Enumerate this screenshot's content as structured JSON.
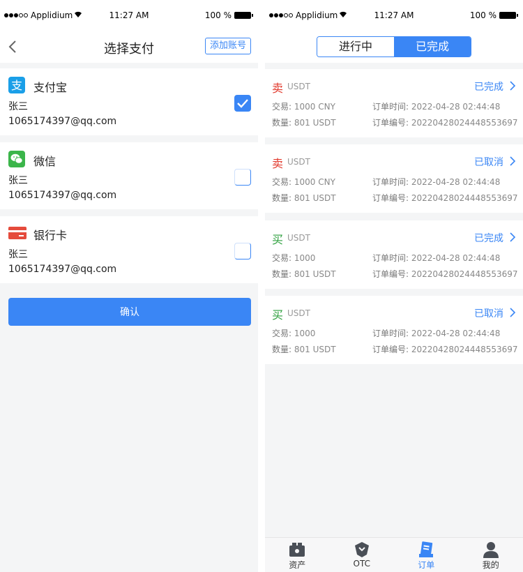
{
  "status_bar": {
    "carrier": "Applidium",
    "time": "11:27 AM",
    "battery": "100 %"
  },
  "select_payment": {
    "title": "选择支付",
    "add_account": "添加账号",
    "methods": [
      {
        "name": "支付宝",
        "holder": "张三",
        "account": "1065174397@qq.com",
        "icon": "alipay-icon",
        "selected": true
      },
      {
        "name": "微信",
        "holder": "张三",
        "account": "1065174397@qq.com",
        "icon": "wechat-icon",
        "selected": false
      },
      {
        "name": "银行卡",
        "holder": "张三",
        "account": "1065174397@qq.com",
        "icon": "bank-card-icon",
        "selected": false
      }
    ],
    "confirm": "确认"
  },
  "orders": {
    "tabs": [
      {
        "label": "进行中",
        "active": false
      },
      {
        "label": "已完成",
        "active": true
      }
    ],
    "labels": {
      "trade": "交易:",
      "quantity": "数量:",
      "order_time": "订单时间:",
      "order_no": "订单编号:"
    },
    "items": [
      {
        "side": "卖",
        "side_type": "sell",
        "coin": "USDT",
        "status": "已完成",
        "trade_amount": "1000",
        "trade_unit": "CNY",
        "quantity": "801",
        "quantity_unit": "USDT",
        "time": "2022-04-28 02:44:48",
        "order_no": "20220428024448553697"
      },
      {
        "side": "卖",
        "side_type": "sell",
        "coin": "USDT",
        "status": "已取消",
        "trade_amount": "1000",
        "trade_unit": "CNY",
        "quantity": "801",
        "quantity_unit": "USDT",
        "time": "2022-04-28 02:44:48",
        "order_no": "20220428024448553697"
      },
      {
        "side": "买",
        "side_type": "buy",
        "coin": "USDT",
        "status": "已完成",
        "trade_amount": "1000",
        "trade_unit": "",
        "quantity": "801",
        "quantity_unit": "USDT",
        "time": "2022-04-28 02:44:48",
        "order_no": "20220428024448553697"
      },
      {
        "side": "买",
        "side_type": "buy",
        "coin": "USDT",
        "status": "已取消",
        "trade_amount": "1000",
        "trade_unit": "",
        "quantity": "801",
        "quantity_unit": "USDT",
        "time": "2022-04-28 02:44:48",
        "order_no": "20220428024448553697"
      }
    ]
  },
  "tabbar": [
    {
      "label": "资产",
      "icon": "wallet-icon",
      "active": false
    },
    {
      "label": "OTC",
      "icon": "otc-icon",
      "active": false
    },
    {
      "label": "订单",
      "icon": "order-icon",
      "active": true
    },
    {
      "label": "我的",
      "icon": "user-icon",
      "active": false
    }
  ],
  "colors": {
    "accent": "#3a86f5",
    "sell": "#e23b2e",
    "buy": "#2c9f3c",
    "background": "#f4f5f6"
  }
}
